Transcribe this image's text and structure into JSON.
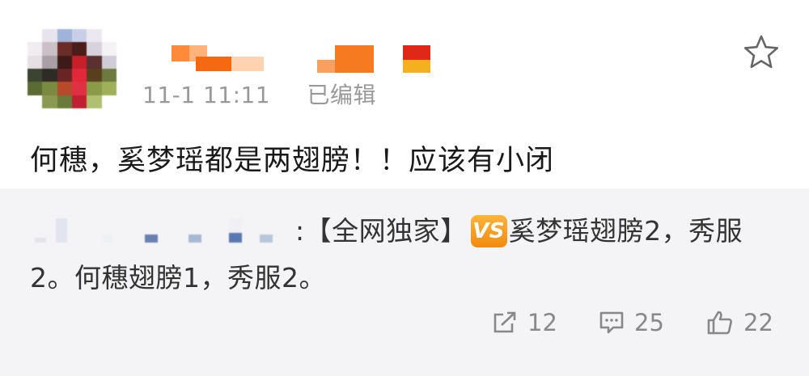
{
  "post": {
    "username": "",
    "timestamp": "11-1 11:11",
    "edited_label": "已编辑",
    "content": "何穗，奚梦瑶都是两翅膀！！应该有小闭"
  },
  "repost": {
    "separator": ":",
    "text_before_icon": "【全网独家】",
    "badge_label": "VS",
    "text_after_icon": "奚梦瑶翅膀2，秀服2。何穗翅膀1，秀服2。"
  },
  "actions": {
    "share_count": "12",
    "comment_count": "25",
    "like_count": "22"
  },
  "icons": [
    "star-icon",
    "share-icon",
    "comment-icon",
    "like-icon"
  ],
  "colors": {
    "badge": "#f5a020",
    "repost_bg": "#f4f4f6",
    "meta_text": "#999999"
  }
}
